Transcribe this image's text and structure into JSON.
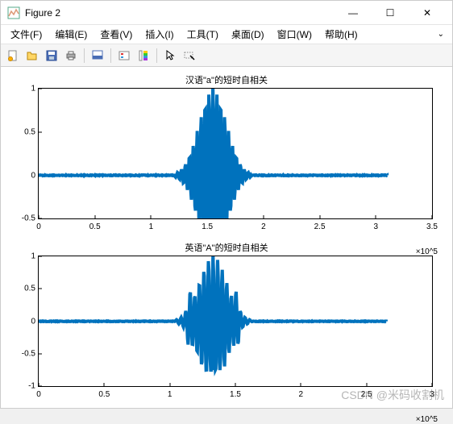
{
  "window": {
    "title": "Figure 2",
    "controls": {
      "minimize": "—",
      "maximize": "☐",
      "close": "✕"
    }
  },
  "menubar": {
    "items": [
      {
        "label": "文件(F)"
      },
      {
        "label": "编辑(E)"
      },
      {
        "label": "查看(V)"
      },
      {
        "label": "插入(I)"
      },
      {
        "label": "工具(T)"
      },
      {
        "label": "桌面(D)"
      },
      {
        "label": "窗口(W)"
      },
      {
        "label": "帮助(H)"
      }
    ]
  },
  "toolbar": {
    "icons": [
      "new-icon",
      "open-icon",
      "save-icon",
      "print-icon",
      "sep",
      "data-cursor-icon",
      "sep",
      "legend-icon",
      "colorbar-icon",
      "sep",
      "pointer-icon",
      "brush-icon"
    ]
  },
  "chart_data": [
    {
      "type": "line",
      "title": "汉语\"a\"的短时自相关",
      "xlabel": "",
      "ylabel": "",
      "xlim": [
        0,
        3.5
      ],
      "ylim": [
        -0.5,
        1.0
      ],
      "x_exponent": "×10^5",
      "y_ticks": [
        -0.5,
        0,
        0.5,
        1
      ],
      "x_ticks": [
        0,
        0.5,
        1,
        1.5,
        2,
        2.5,
        3,
        3.5
      ],
      "series": [
        {
          "name": "autocorrelation",
          "color": "#0072BD",
          "description": "Near-zero baseline across 0..3.1e5 with symmetric burst centered at x≈1.55e5; central peak reaches 1.0, surrounding lobes oscillate roughly between -0.55 and 0.6; envelope width ≈ 0.38e5 on each side.",
          "peak_x": 1.55,
          "peak_y": 1.0,
          "min_y": -0.55,
          "signal_end": 3.1
        }
      ]
    },
    {
      "type": "line",
      "title": "英语\"A\"的短时自相关",
      "xlabel": "",
      "ylabel": "",
      "xlim": [
        0,
        3.0
      ],
      "ylim": [
        -1.0,
        1.0
      ],
      "x_exponent": "×10^5",
      "y_ticks": [
        -1,
        -0.5,
        0,
        0.5,
        1
      ],
      "x_ticks": [
        0,
        0.5,
        1,
        1.5,
        2,
        2.5,
        3
      ],
      "series": [
        {
          "name": "autocorrelation",
          "color": "#0072BD",
          "description": "Near-zero baseline across 0..2.65e5 with burst centered at x≈1.33e5; central peak to 1.0 and trough ≈ -0.75; two small side-bursts at ≈1.15e5 and ≈1.52e5 reaching ±0.25; envelope width ≈ 0.25e5 on each side.",
          "peak_x": 1.33,
          "peak_y": 1.0,
          "min_y": -0.75,
          "signal_end": 2.65
        }
      ]
    }
  ],
  "watermark": "CSDN @米码收割机"
}
